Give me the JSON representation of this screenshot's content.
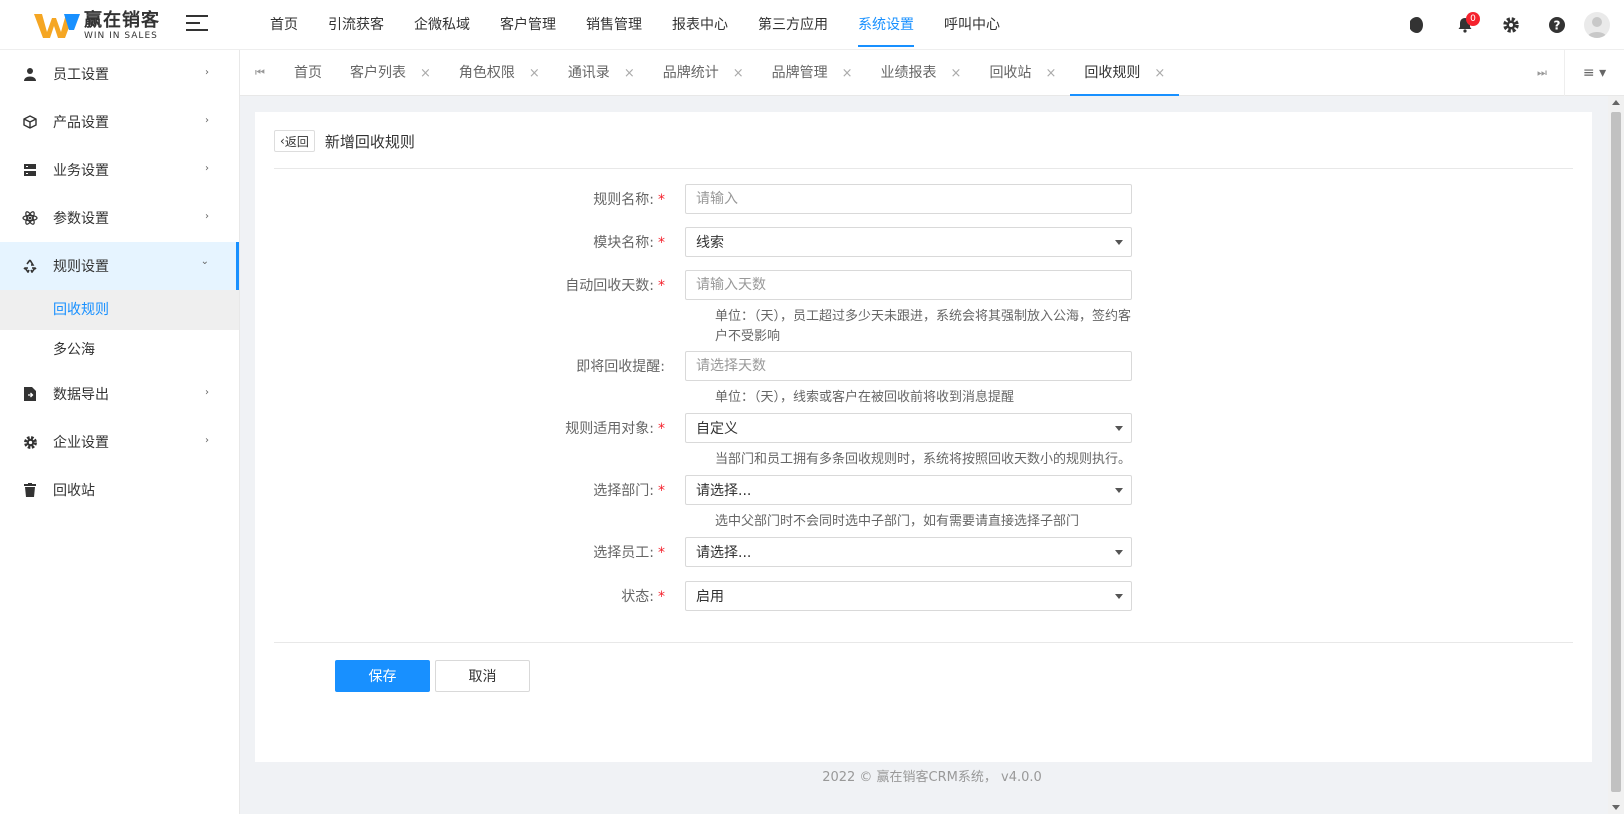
{
  "brand": {
    "name_cn": "赢在销客",
    "name_en": "WIN IN SALES",
    "accent": "#1890ff"
  },
  "topnav": {
    "items": [
      "首页",
      "引流获客",
      "企微私域",
      "客户管理",
      "销售管理",
      "报表中心",
      "第三方应用",
      "系统设置",
      "呼叫中心"
    ],
    "active": "系统设置"
  },
  "header_icons": {
    "notifications_count": "0"
  },
  "sidebar": {
    "items": [
      {
        "label": "员工设置",
        "icon": "user-icon"
      },
      {
        "label": "产品设置",
        "icon": "box-icon"
      },
      {
        "label": "业务设置",
        "icon": "server-icon"
      },
      {
        "label": "参数设置",
        "icon": "atom-icon"
      },
      {
        "label": "规则设置",
        "icon": "recycle-icon"
      },
      {
        "label": "数据导出",
        "icon": "file-export-icon"
      },
      {
        "label": "企业设置",
        "icon": "gear-icon"
      },
      {
        "label": "回收站",
        "icon": "trash-icon"
      }
    ],
    "sub_items": [
      "回收规则",
      "多公海"
    ],
    "active_sub": "回收规则"
  },
  "tabs": {
    "items": [
      "首页",
      "客户列表",
      "角色权限",
      "通讯录",
      "品牌统计",
      "品牌管理",
      "业绩报表",
      "回收站",
      "回收规则"
    ],
    "close_glyph": "×"
  },
  "page": {
    "back_label": "返回",
    "title": "新增回收规则"
  },
  "form": {
    "rule_name": {
      "label": "规则名称:",
      "placeholder": "请输入"
    },
    "module_name": {
      "label": "模块名称:",
      "value": "线索"
    },
    "auto_days": {
      "label": "自动回收天数:",
      "placeholder": "请输入天数",
      "help": "单位：（天），员工超过多少天未跟进，系统会将其强制放入公海，签约客户不受影响"
    },
    "remind": {
      "label": "即将回收提醒:",
      "placeholder": "请选择天数",
      "help": "单位：（天），线索或客户在被回收前将收到消息提醒"
    },
    "target": {
      "label": "规则适用对象:",
      "value": "自定义",
      "help": "当部门和员工拥有多条回收规则时，系统将按照回收天数小的规则执行。"
    },
    "department": {
      "label": "选择部门:",
      "value": "请选择...",
      "help": "选中父部门时不会同时选中子部门，如有需要请直接选择子部门"
    },
    "employee": {
      "label": "选择员工:",
      "value": "请选择..."
    },
    "status": {
      "label": "状态:",
      "value": "启用"
    },
    "required_mark": "*"
  },
  "actions": {
    "save": "保存",
    "cancel": "取消"
  },
  "footer": "2022 © 赢在销客CRM系统， v4.0.0"
}
